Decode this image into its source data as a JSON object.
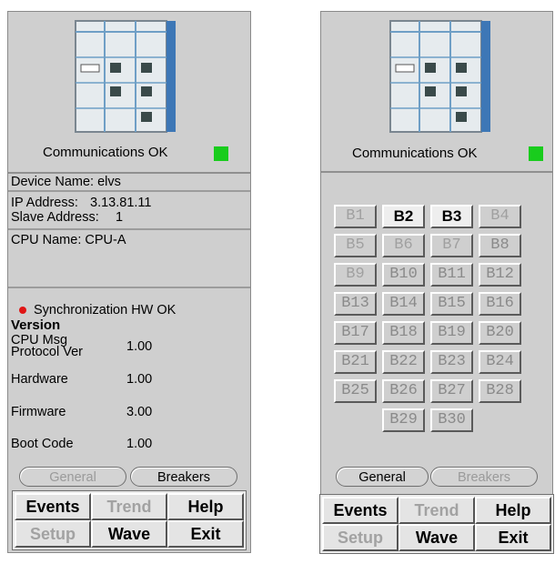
{
  "left": {
    "communications_status": "Communications OK",
    "device_name": "Device Name:  elvs",
    "ip_address_label": "IP Address:",
    "ip_address": "3.13.81.11",
    "slave_address_label": "Slave Address:",
    "slave_address": "1",
    "cpu_name": "CPU Name:  CPU-A",
    "sync_status": "Synchronization HW OK",
    "version_heading": "Version",
    "versions": [
      {
        "label1": "CPU Msg",
        "label2": "Protocol Ver",
        "value": "1.00"
      },
      {
        "label1": "Hardware",
        "value": "1.00"
      },
      {
        "label1": "Firmware",
        "value": "3.00"
      },
      {
        "label1": "Boot Code",
        "value": "1.00"
      }
    ],
    "tabs": {
      "general": "General",
      "breakers": "Breakers"
    },
    "buttons": {
      "events": "Events",
      "trend": "Trend",
      "help": "Help",
      "setup": "Setup",
      "wave": "Wave",
      "exit": "Exit"
    }
  },
  "right": {
    "communications_status": "Communications OK",
    "breakers": [
      {
        "label": "B1",
        "state": "dim"
      },
      {
        "label": "B2",
        "state": "on"
      },
      {
        "label": "B3",
        "state": "on"
      },
      {
        "label": "B4",
        "state": "dim"
      },
      {
        "label": "B5",
        "state": "dim"
      },
      {
        "label": "B6",
        "state": "dim"
      },
      {
        "label": "B7",
        "state": "dim"
      },
      {
        "label": "B8",
        "state": "mid"
      },
      {
        "label": "B9",
        "state": "dim"
      },
      {
        "label": "B10",
        "state": "mid"
      },
      {
        "label": "B11",
        "state": "mid"
      },
      {
        "label": "B12",
        "state": "mid"
      },
      {
        "label": "B13",
        "state": "mid"
      },
      {
        "label": "B14",
        "state": "mid"
      },
      {
        "label": "B15",
        "state": "mid"
      },
      {
        "label": "B16",
        "state": "mid"
      },
      {
        "label": "B17",
        "state": "mid"
      },
      {
        "label": "B18",
        "state": "mid"
      },
      {
        "label": "B19",
        "state": "mid"
      },
      {
        "label": "B20",
        "state": "mid"
      },
      {
        "label": "B21",
        "state": "mid"
      },
      {
        "label": "B22",
        "state": "mid"
      },
      {
        "label": "B23",
        "state": "mid"
      },
      {
        "label": "B24",
        "state": "mid"
      },
      {
        "label": "B25",
        "state": "mid"
      },
      {
        "label": "B26",
        "state": "mid"
      },
      {
        "label": "B27",
        "state": "mid"
      },
      {
        "label": "B28",
        "state": "mid"
      },
      {
        "label": "B29",
        "state": "mid"
      },
      {
        "label": "B30",
        "state": "mid"
      }
    ],
    "tabs": {
      "general": "General",
      "breakers": "Breakers"
    },
    "buttons": {
      "events": "Events",
      "trend": "Trend",
      "help": "Help",
      "setup": "Setup",
      "wave": "Wave",
      "exit": "Exit"
    }
  },
  "colors": {
    "status_ok": "#19cc1d",
    "sync_dot": "#e01616",
    "panel_bg": "#cfcfcf"
  }
}
